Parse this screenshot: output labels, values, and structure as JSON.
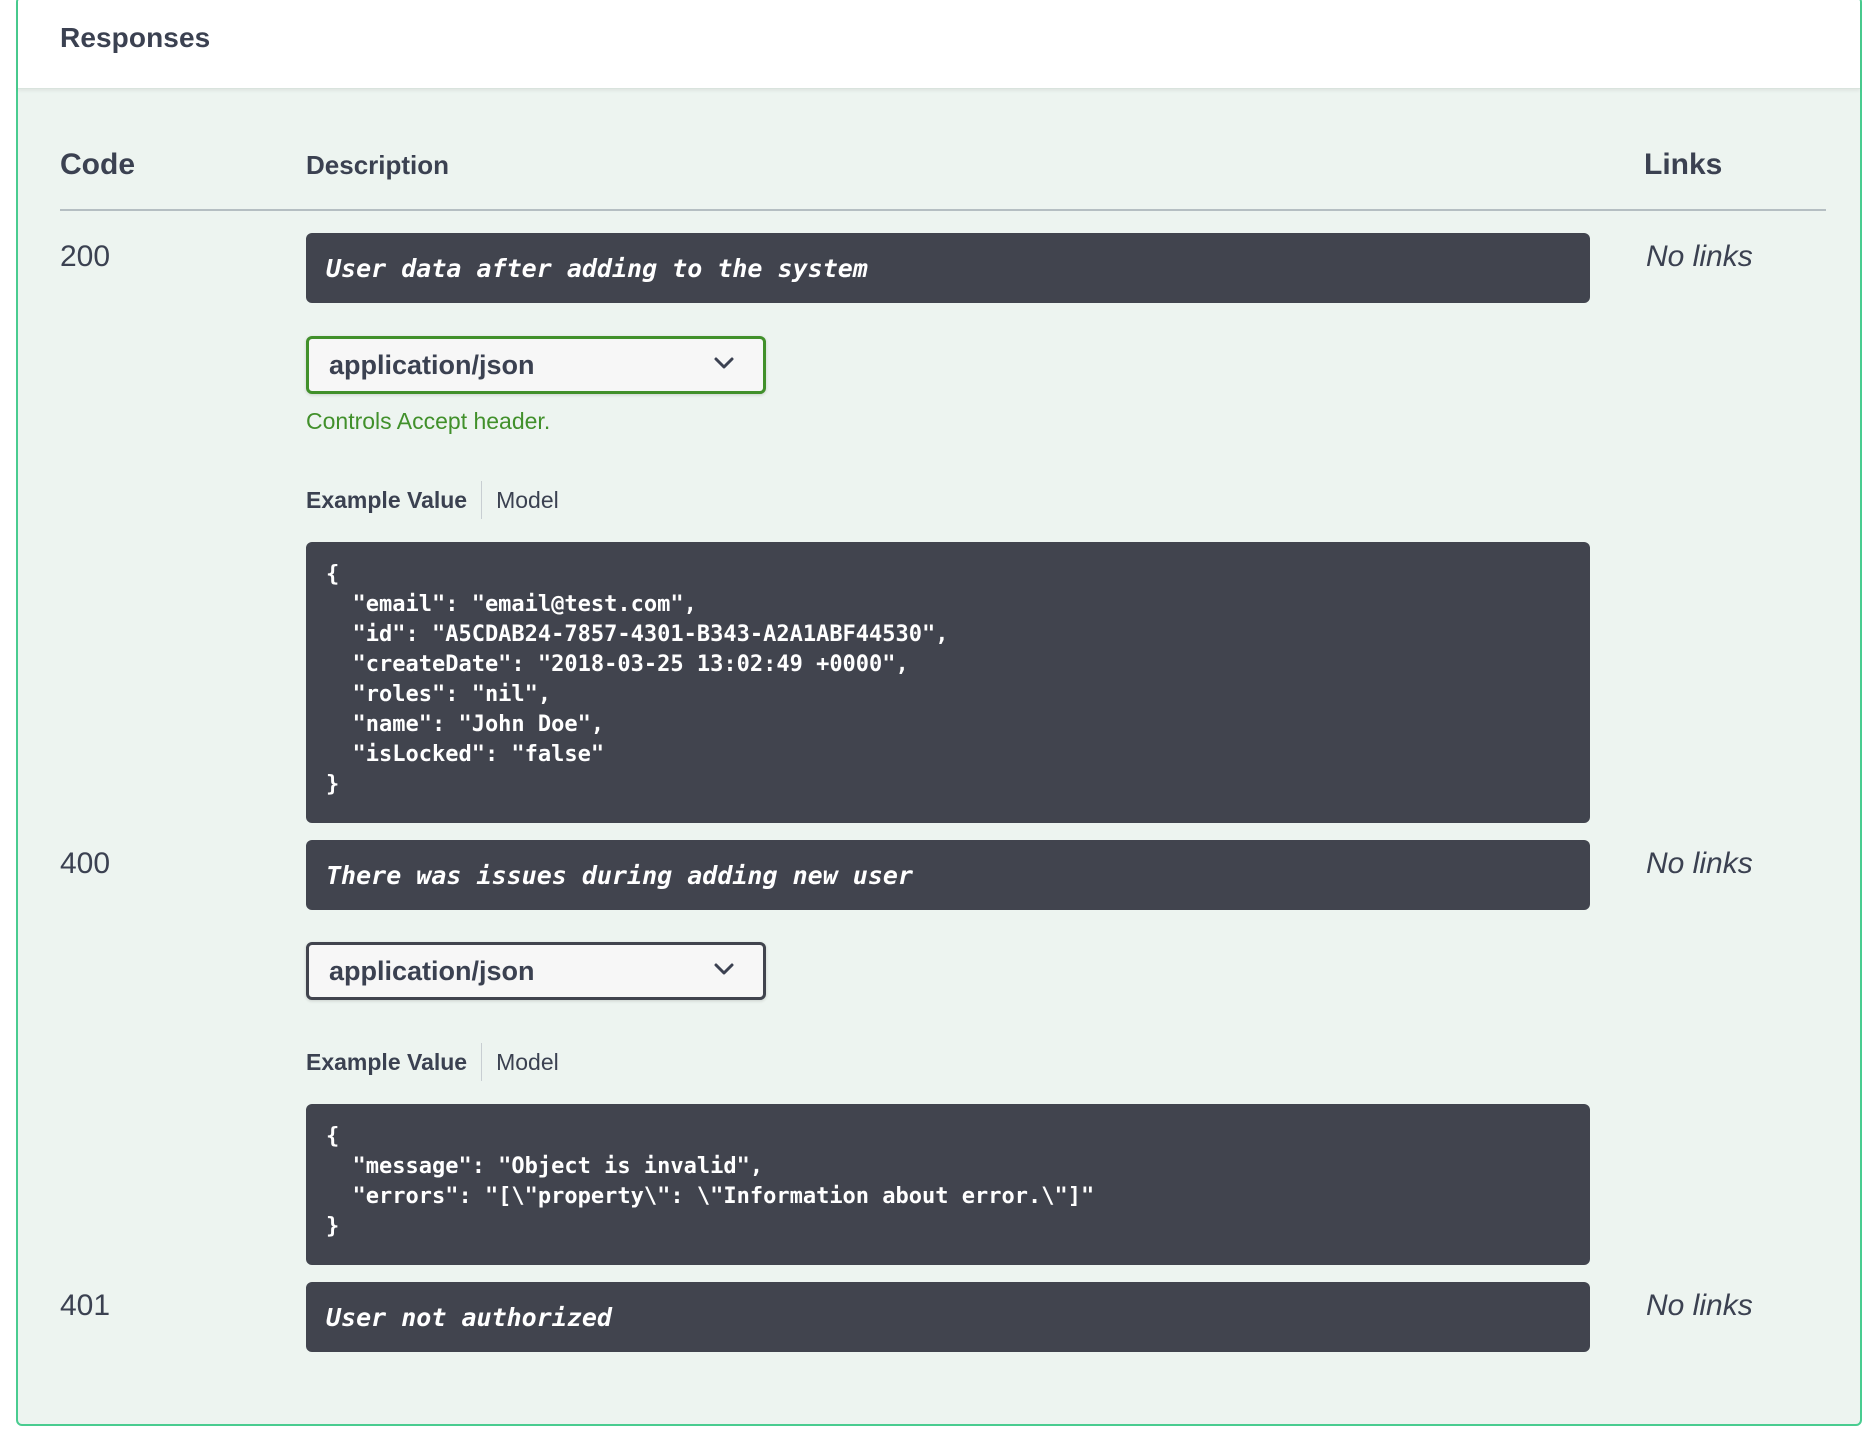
{
  "responses": {
    "title": "Responses",
    "columns": {
      "code": "Code",
      "description": "Description",
      "links": "Links"
    },
    "items": [
      {
        "code": "200",
        "description": "User data after adding to the system",
        "links": "No links",
        "media_type": "application/json",
        "media_hint": "Controls Accept header.",
        "tab_example": "Example Value",
        "tab_model": "Model",
        "example": "{\n  \"email\": \"email@test.com\",\n  \"id\": \"A5CDAB24-7857-4301-B343-A2A1ABF44530\",\n  \"createDate\": \"2018-03-25 13:02:49 +0000\",\n  \"roles\": \"nil\",\n  \"name\": \"John Doe\",\n  \"isLocked\": \"false\"\n}"
      },
      {
        "code": "400",
        "description": "There was issues during adding new user",
        "links": "No links",
        "media_type": "application/json",
        "tab_example": "Example Value",
        "tab_model": "Model",
        "example": "{\n  \"message\": \"Object is invalid\",\n  \"errors\": \"[\\\"property\\\": \\\"Information about error.\\\"]\"\n}"
      },
      {
        "code": "401",
        "description": "User not authorized",
        "links": "No links"
      }
    ]
  },
  "colors": {
    "accent_green": "#49cc90",
    "hint_green": "#41902b",
    "code_background": "#41444e",
    "panel_background": "#edf4f0"
  },
  "icons": {
    "select_caret": "chevron-down-icon"
  }
}
